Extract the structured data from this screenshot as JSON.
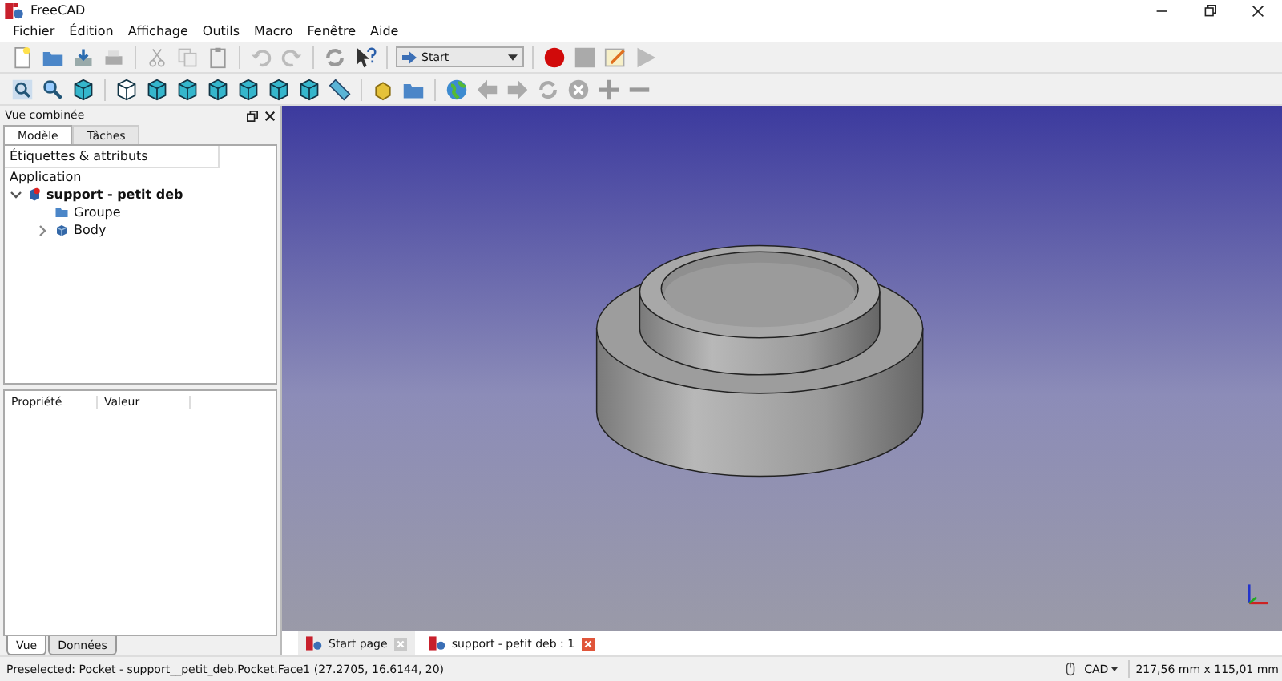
{
  "window": {
    "title": "FreeCAD"
  },
  "menu": [
    "Fichier",
    "Édition",
    "Affichage",
    "Outils",
    "Macro",
    "Fenêtre",
    "Aide"
  ],
  "workbench": {
    "value": "Start"
  },
  "combo_view": {
    "title": "Vue combinée",
    "tabs": [
      {
        "label": "Modèle",
        "selected": true
      },
      {
        "label": "Tâches",
        "selected": false
      }
    ],
    "tree_header": "Étiquettes & attributs",
    "tree": [
      {
        "label": "Application",
        "children": [
          {
            "label": "support - petit deb",
            "expanded": true,
            "children": [
              {
                "label": "Groupe",
                "kind": "group"
              },
              {
                "label": "Body",
                "kind": "body",
                "expanded": false
              }
            ]
          }
        ]
      }
    ],
    "property_columns": [
      "Propriété",
      "Valeur"
    ],
    "bottom_tabs": [
      {
        "label": "Vue",
        "selected": true
      },
      {
        "label": "Données",
        "selected": false
      }
    ]
  },
  "document_tabs": [
    {
      "label": "Start page",
      "selected": false
    },
    {
      "label": "support - petit deb : 1",
      "selected": true
    }
  ],
  "status_bar": {
    "message": "Preselected: Pocket - support__petit_deb.Pocket.Face1 (27.2705, 16.6144, 20)",
    "nav_style": "CAD",
    "dimensions": "217,56 mm x 115,01 mm"
  }
}
